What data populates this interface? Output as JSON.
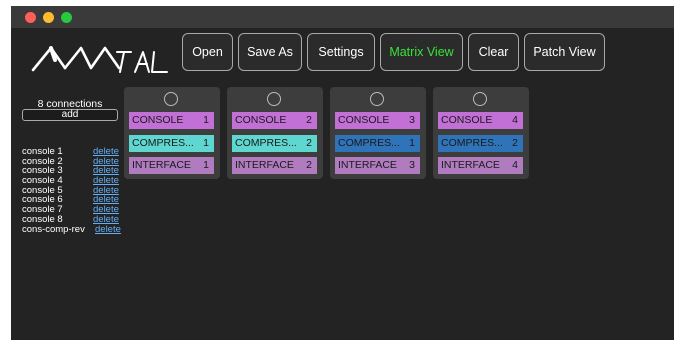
{
  "window": {
    "controls": [
      "close",
      "minimize",
      "zoom"
    ],
    "logo_text": "AMATRL"
  },
  "toolbar": {
    "buttons": [
      {
        "label": "Open",
        "active": false
      },
      {
        "label": "Save As",
        "active": false
      },
      {
        "label": "Settings",
        "active": false
      },
      {
        "label": "Matrix View",
        "active": true
      },
      {
        "label": "Clear",
        "active": false
      },
      {
        "label": "Patch View",
        "active": false
      }
    ]
  },
  "sidebar": {
    "connections_count": "8 connections",
    "add_label": "add",
    "delete_label": "delete",
    "connections": [
      "console 1",
      "console 2",
      "console 3",
      "console 4",
      "console 5",
      "console 6",
      "console 7",
      "console 8",
      "cons-comp-rev"
    ]
  },
  "matrix": {
    "cards": [
      {
        "rows": [
          {
            "label": "CONSOLE",
            "num": "1",
            "type": "console"
          },
          {
            "label": "COMPRES...",
            "num": "1",
            "type": "compres",
            "color": "teal"
          },
          {
            "label": "INTERFACE",
            "num": "1",
            "type": "interface"
          }
        ]
      },
      {
        "rows": [
          {
            "label": "CONSOLE",
            "num": "2",
            "type": "console"
          },
          {
            "label": "COMPRES...",
            "num": "2",
            "type": "compres",
            "color": "teal"
          },
          {
            "label": "INTERFACE",
            "num": "2",
            "type": "interface"
          }
        ]
      },
      {
        "rows": [
          {
            "label": "CONSOLE",
            "num": "3",
            "type": "console"
          },
          {
            "label": "COMPRES...",
            "num": "1",
            "type": "compres",
            "color": "blue"
          },
          {
            "label": "INTERFACE",
            "num": "3",
            "type": "interface"
          }
        ]
      },
      {
        "rows": [
          {
            "label": "CONSOLE",
            "num": "4",
            "type": "console"
          },
          {
            "label": "COMPRES...",
            "num": "2",
            "type": "compres",
            "color": "blue"
          },
          {
            "label": "INTERFACE",
            "num": "4",
            "type": "interface"
          }
        ]
      }
    ]
  },
  "colors": {
    "console": "#c270d5",
    "compres_teal": "#5fd6d0",
    "compres_blue": "#2f73b8",
    "interface": "#b07cbf",
    "active_button_text": "#37e437",
    "delete_link": "#65aef5"
  }
}
